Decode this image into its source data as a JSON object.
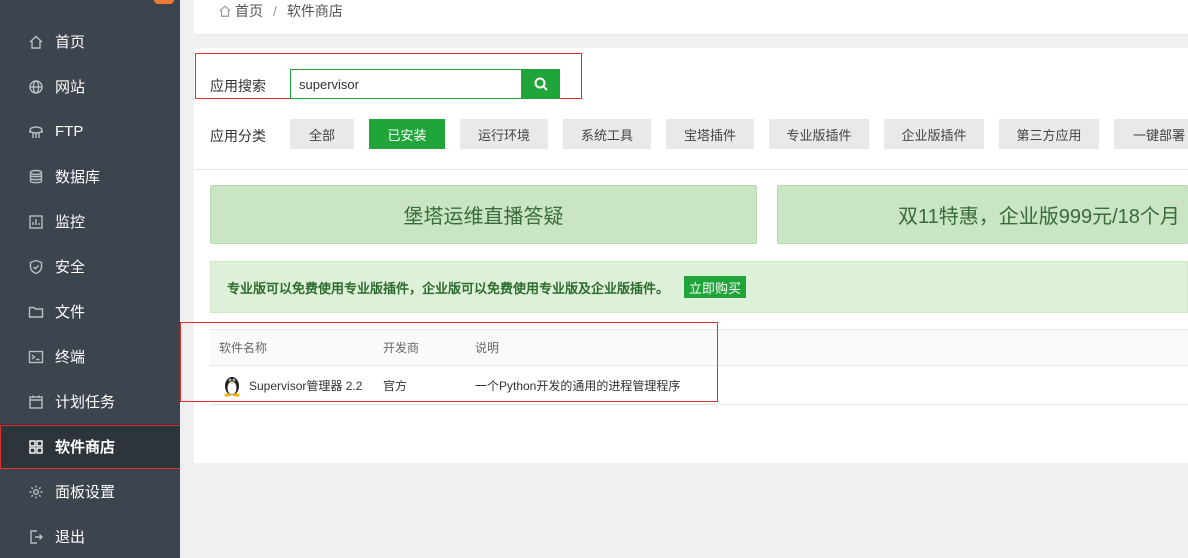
{
  "sidebar": {
    "items": [
      {
        "label": "首页",
        "icon": "home-icon"
      },
      {
        "label": "网站",
        "icon": "globe-icon"
      },
      {
        "label": "FTP",
        "icon": "ftp-icon"
      },
      {
        "label": "数据库",
        "icon": "database-icon"
      },
      {
        "label": "监控",
        "icon": "monitor-icon"
      },
      {
        "label": "安全",
        "icon": "shield-icon"
      },
      {
        "label": "文件",
        "icon": "folder-icon"
      },
      {
        "label": "终端",
        "icon": "terminal-icon"
      },
      {
        "label": "计划任务",
        "icon": "calendar-icon"
      },
      {
        "label": "软件商店",
        "icon": "grid-icon",
        "active": true
      },
      {
        "label": "面板设置",
        "icon": "gear-icon"
      },
      {
        "label": "退出",
        "icon": "logout-icon"
      }
    ]
  },
  "breadcrumb": {
    "home": "首页",
    "separator": "/",
    "current": "软件商店"
  },
  "search": {
    "label": "应用搜索",
    "value": "supervisor"
  },
  "categories": {
    "label": "应用分类",
    "items": [
      "全部",
      "已安装",
      "运行环境",
      "系统工具",
      "宝塔插件",
      "专业版插件",
      "企业版插件",
      "第三方应用",
      "一键部署"
    ],
    "active": "已安装"
  },
  "banners": [
    "堡塔运维直播答疑",
    "双11特惠，企业版999元/18个月"
  ],
  "notice": {
    "text": "专业版可以免费使用专业版插件，企业版可以免费使用专业版及企业版插件。",
    "button": "立即购买"
  },
  "table": {
    "headers": [
      "软件名称",
      "开发商",
      "说明"
    ],
    "rows": [
      {
        "name": "Supervisor管理器 2.2",
        "developer": "官方",
        "description": "一个Python开发的通用的进程管理程序"
      }
    ]
  },
  "colors": {
    "accent": "#20a53a",
    "sidebar": "#3c444d",
    "highlight": "#e03030"
  }
}
